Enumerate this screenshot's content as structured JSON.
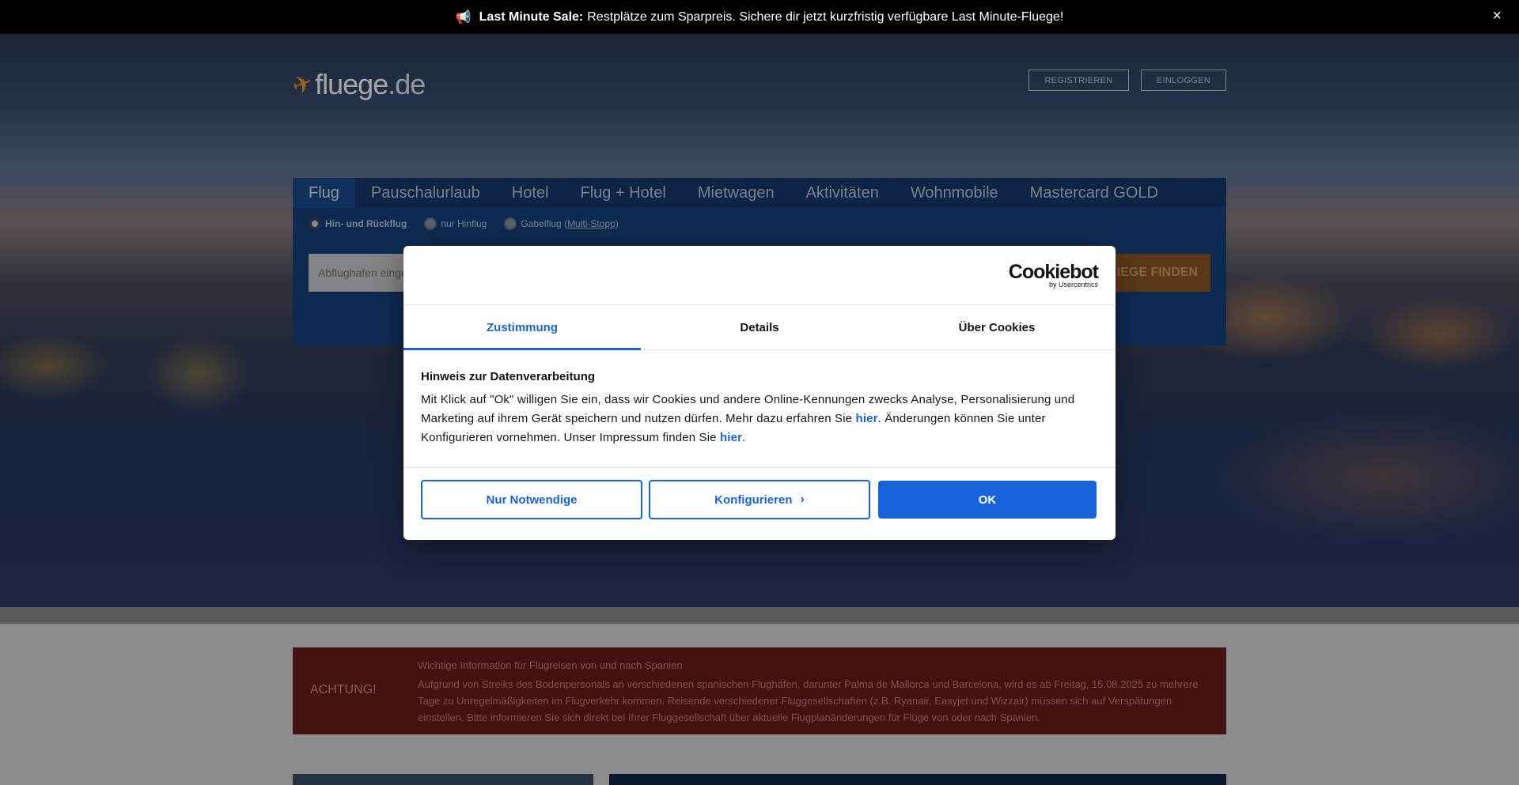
{
  "promo": {
    "icon": "megaphone-icon",
    "bold": "Last Minute Sale:",
    "text": "Restplätze zum Sparpreis. Sichere dir jetzt kurzfristig verfügbare Last Minute-Fluege!",
    "close": "×"
  },
  "header": {
    "logo_name": "fluege",
    "logo_tld": ".de",
    "register": "REGISTRIEREN",
    "login": "EINLOGGEN"
  },
  "search": {
    "tabs": [
      "Flug",
      "Pauschalurlaub",
      "Hotel",
      "Flug + Hotel",
      "Mietwagen",
      "Aktivitäten",
      "Wohnmobile",
      "Mastercard GOLD"
    ],
    "trip_types": {
      "roundtrip": "Hin- und Rückflug",
      "oneway": "nur Hinflug",
      "multi_prefix": "Gabelflug (",
      "multi_link": "Multi-Stopp",
      "multi_suffix": ")"
    },
    "origin_placeholder": "Abflughafen eingeben",
    "origin_visible": "Abflughafen einge",
    "find_button": "FLÜGE FINDEN",
    "find_visible": "IEGE FINDEN"
  },
  "alert": {
    "title": "ACHTUNG!",
    "headline": "Wichtige Information für Flugreisen von und nach Spanien",
    "body": "Aufgrund von Streiks des Bodenpersonals an verschiedenen spanischen Flughäfen, darunter Palma de Mallorca und Barcelona, wird es ab Freitag, 15.08.2025 zu mehrere Tage zu Unregelmäßigkeiten im Flugverkehr kommen. Reisende verschiedener Fluggesellschaften (z.B. Ryanair, Easyjet und Wizzair) müssen sich auf Verspätungen einstellen. Bitte informieren Sie sich direkt bei Ihrer Fluggesellschaft über aktuelle Flugplanänderungen für Flüge von oder nach Spanien."
  },
  "cookie": {
    "brand": "Cookiebot",
    "brand_by": "by Usercentrics",
    "tabs": {
      "consent": "Zustimmung",
      "details": "Details",
      "about": "Über Cookies"
    },
    "heading": "Hinweis zur Datenverarbeitung",
    "text_1": "Mit Klick auf \"Ok\" willigen Sie ein, dass wir Cookies und andere Online-Kennungen zwecks Analyse, Personalisierung und Marketing auf ihrem Gerät speichern und nutzen dürfen. Mehr dazu erfahren Sie ",
    "link_1": "hier",
    "text_2": ". Änderungen können Sie unter Konfigurieren vornehmen. Unser Impressum finden Sie ",
    "link_2": "hier",
    "text_3": ".",
    "buttons": {
      "necessary": "Nur Notwendige",
      "configure": "Konfigurieren",
      "ok": "OK"
    }
  },
  "colors": {
    "accent": "#1863dc",
    "alert_bg": "#731e1e",
    "search_bg": "#17417f",
    "brand_orange": "#f29b1c"
  }
}
